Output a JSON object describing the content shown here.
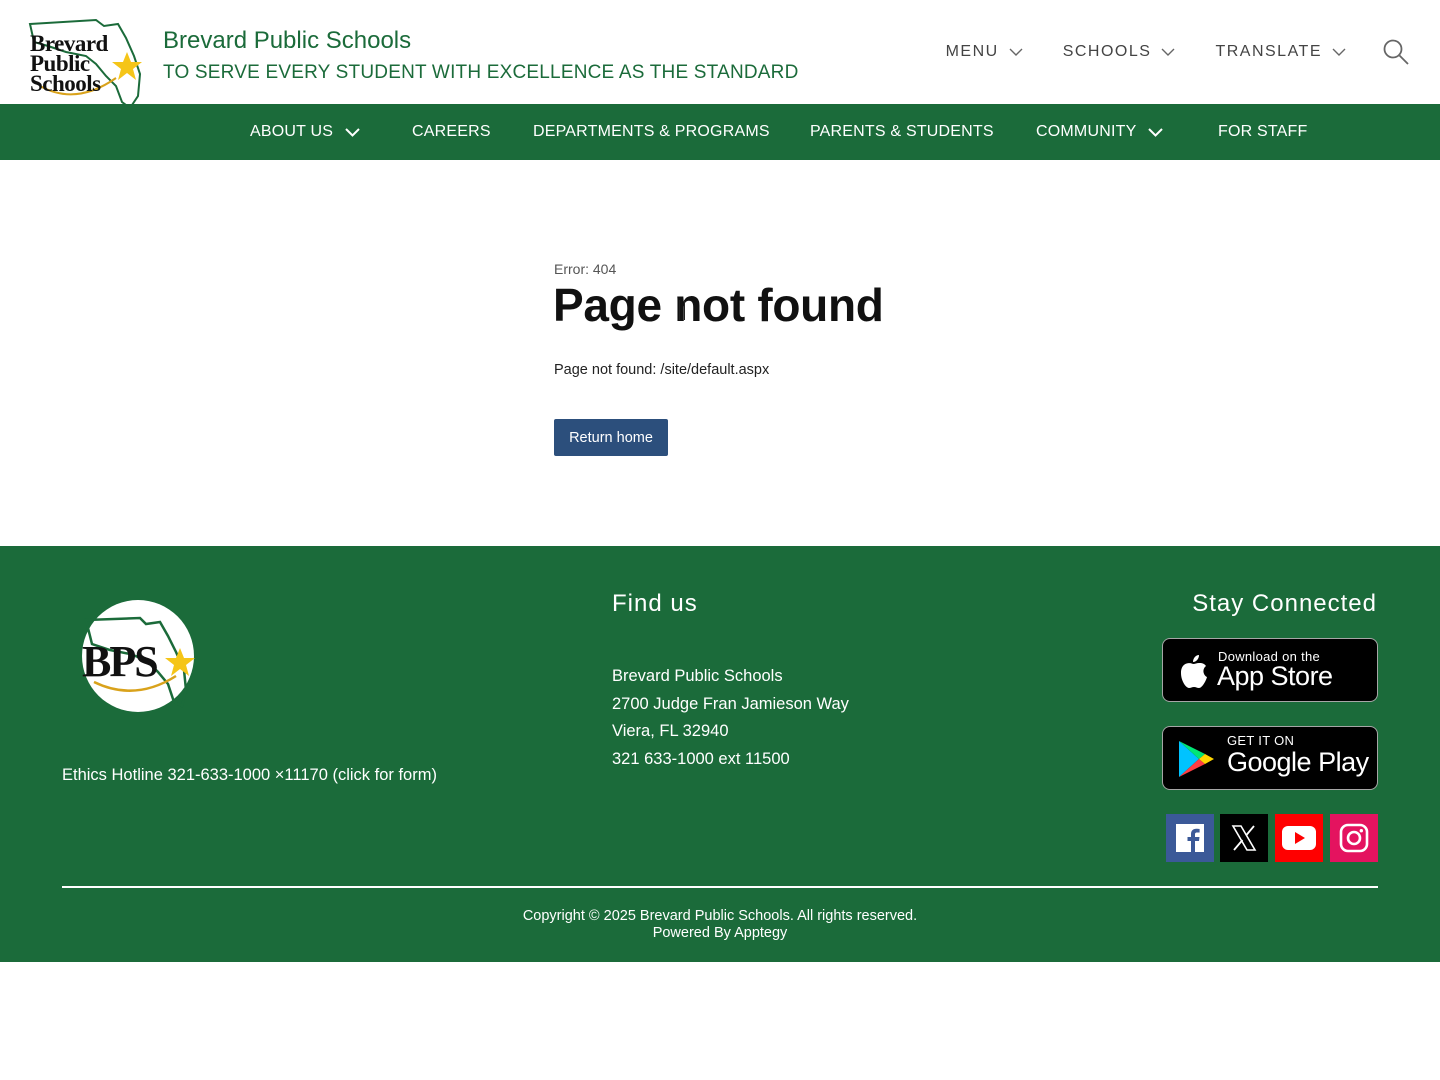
{
  "header": {
    "logo_lines": [
      "Brevard",
      "Public",
      "Schools"
    ],
    "title": "Brevard Public Schools",
    "tagline": "TO SERVE EVERY STUDENT WITH EXCELLENCE AS THE STANDARD",
    "utility_nav": [
      {
        "label": "MENU",
        "icon": "chevron-down-icon"
      },
      {
        "label": "SCHOOLS",
        "icon": "chevron-down-icon"
      },
      {
        "label": "TRANSLATE",
        "icon": "chevron-down-icon"
      }
    ],
    "search_icon": "search-icon"
  },
  "main_nav": {
    "items": [
      {
        "label": "ABOUT US",
        "has_dropdown": true
      },
      {
        "label": "CAREERS",
        "has_dropdown": false
      },
      {
        "label": "DEPARTMENTS & PROGRAMS",
        "has_dropdown": false
      },
      {
        "label": "PARENTS & STUDENTS",
        "has_dropdown": false
      },
      {
        "label": "COMMUNITY",
        "has_dropdown": true
      },
      {
        "label": "FOR STAFF",
        "has_dropdown": false
      }
    ]
  },
  "content": {
    "error_code": "Error: 404",
    "title": "Page not found",
    "message": "Page not found: /site/default.aspx",
    "return_button": "Return home"
  },
  "footer": {
    "logo_text": "BPS",
    "ethics": "Ethics Hotline 321-633-1000 ×11170 (click for form)",
    "find_title": "Find us",
    "address": {
      "name": "Brevard Public Schools",
      "street": "2700 Judge Fran Jamieson Way",
      "city": "Viera, FL 32940",
      "phone": "321 633-1000 ext 11500"
    },
    "stay_title": "Stay Connected",
    "app_store": {
      "small": "Download on the",
      "big": "App Store"
    },
    "google_play": {
      "small": "GET IT ON",
      "big": "Google Play"
    },
    "social": [
      {
        "name": "facebook",
        "color": "#3b5998"
      },
      {
        "name": "x",
        "color": "#000000"
      },
      {
        "name": "youtube",
        "color": "#ff0000"
      },
      {
        "name": "instagram",
        "color": "#e4135f"
      }
    ],
    "copyright": "Copyright © 2025 Brevard Public Schools. All rights reserved.",
    "powered_by": "Powered By Apptegy"
  },
  "colors": {
    "brand_green": "#1b6b3a",
    "button_blue": "#2c4f7c"
  }
}
